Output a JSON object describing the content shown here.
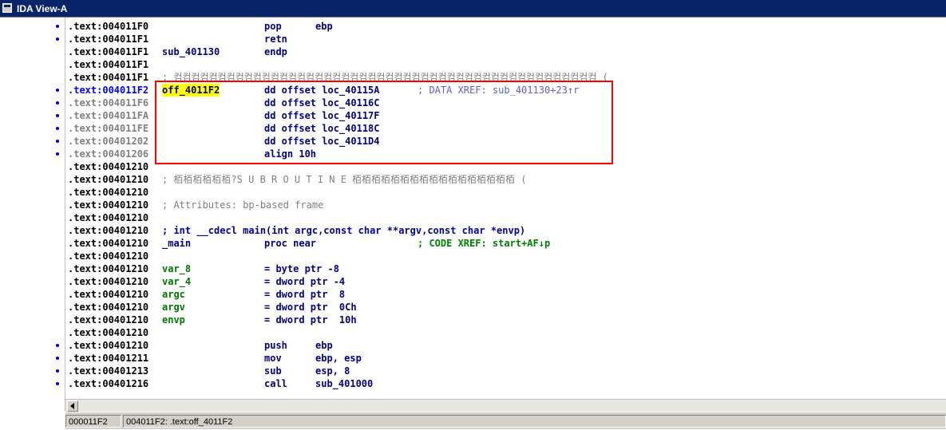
{
  "window": {
    "title": "IDA View-A"
  },
  "listing": [
    {
      "seg": ".text:",
      "addr": "004011F0",
      "mn": "pop",
      "op": "ebp",
      "dot": true
    },
    {
      "seg": ".text:",
      "addr": "004011F1",
      "mn": "retn",
      "op": "",
      "dot": true
    },
    {
      "seg": ".text:",
      "addr": "004011F1",
      "lbl": "sub_401130",
      "mn": "endp",
      "op": ""
    },
    {
      "seg": ".text:",
      "addr": "004011F1"
    },
    {
      "seg": ".text:",
      "addr": "004011F1",
      "comment_full": "; 컴컴컴컴컴컴컴컴컴컴컴컴컴컴컴컴컴컴컴컴컴컴컴컴컴컴컴컴컴컴컴컴컴컴컴컴컴컴컴컴컴컴컴컴컴컴컴컴 ("
    },
    {
      "seg": ".text:",
      "addr": "004011F2",
      "lbl": "off_4011F2",
      "mn": "dd offset loc_40115A",
      "comment": "; DATA XREF: sub_401130+23↑r",
      "dot": true,
      "blue_addr": true
    },
    {
      "seg": ".text:",
      "addr": "004011F6",
      "mn": "dd offset loc_40116C",
      "dot": true,
      "grey_addr": true
    },
    {
      "seg": ".text:",
      "addr": "004011FA",
      "mn": "dd offset loc_40117F",
      "dot": true,
      "grey_addr": true
    },
    {
      "seg": ".text:",
      "addr": "004011FE",
      "mn": "dd offset loc_40118C",
      "dot": true,
      "grey_addr": true
    },
    {
      "seg": ".text:",
      "addr": "00401202",
      "mn": "dd offset loc_4011D4",
      "dot": true,
      "grey_addr": true
    },
    {
      "seg": ".text:",
      "addr": "00401206",
      "mn": "align 10h",
      "dot": true,
      "grey_addr": true
    },
    {
      "seg": ".text:",
      "addr": "00401210"
    },
    {
      "seg": ".text:",
      "addr": "00401210",
      "comment_full": "; 栢栢栢栢栢栢?S U B R O U T I N E 栢栢栢栢栢栢栢栢栢栢栢栢栢栢栢栢栢 ("
    },
    {
      "seg": ".text:",
      "addr": "00401210"
    },
    {
      "seg": ".text:",
      "addr": "00401210",
      "comment_full": "; Attributes: bp-based frame"
    },
    {
      "seg": ".text:",
      "addr": "00401210"
    },
    {
      "seg": ".text:",
      "addr": "00401210",
      "comment_full": "; int __cdecl main(int argc,const char **argv,const char *envp)",
      "proto": true
    },
    {
      "seg": ".text:",
      "addr": "00401210",
      "lbl": "_main",
      "mn": "proc near",
      "comment": "; CODE XREF: start+AF↓p"
    },
    {
      "seg": ".text:",
      "addr": "00401210"
    },
    {
      "seg": ".text:",
      "addr": "00401210",
      "lbl": "var_8",
      "mn": "= byte ptr -8"
    },
    {
      "seg": ".text:",
      "addr": "00401210",
      "lbl": "var_4",
      "mn": "= dword ptr -4"
    },
    {
      "seg": ".text:",
      "addr": "00401210",
      "lbl": "argc",
      "mn": "= dword ptr  8"
    },
    {
      "seg": ".text:",
      "addr": "00401210",
      "lbl": "argv",
      "mn": "= dword ptr  0Ch"
    },
    {
      "seg": ".text:",
      "addr": "00401210",
      "lbl": "envp",
      "mn": "= dword ptr  10h"
    },
    {
      "seg": ".text:",
      "addr": "00401210"
    },
    {
      "seg": ".text:",
      "addr": "00401210",
      "mn": "push",
      "op": "ebp",
      "dot": true
    },
    {
      "seg": ".text:",
      "addr": "00401211",
      "mn": "mov",
      "op": "ebp, esp",
      "dot": true
    },
    {
      "seg": ".text:",
      "addr": "00401213",
      "mn": "sub",
      "op": "esp, 8",
      "dot": true
    },
    {
      "seg": ".text:",
      "addr": "00401216",
      "mn": "call",
      "op": "sub_401000",
      "dot": true
    }
  ],
  "status": {
    "offset": "000011F2",
    "location": "004011F2: .text:off_4011F2"
  }
}
